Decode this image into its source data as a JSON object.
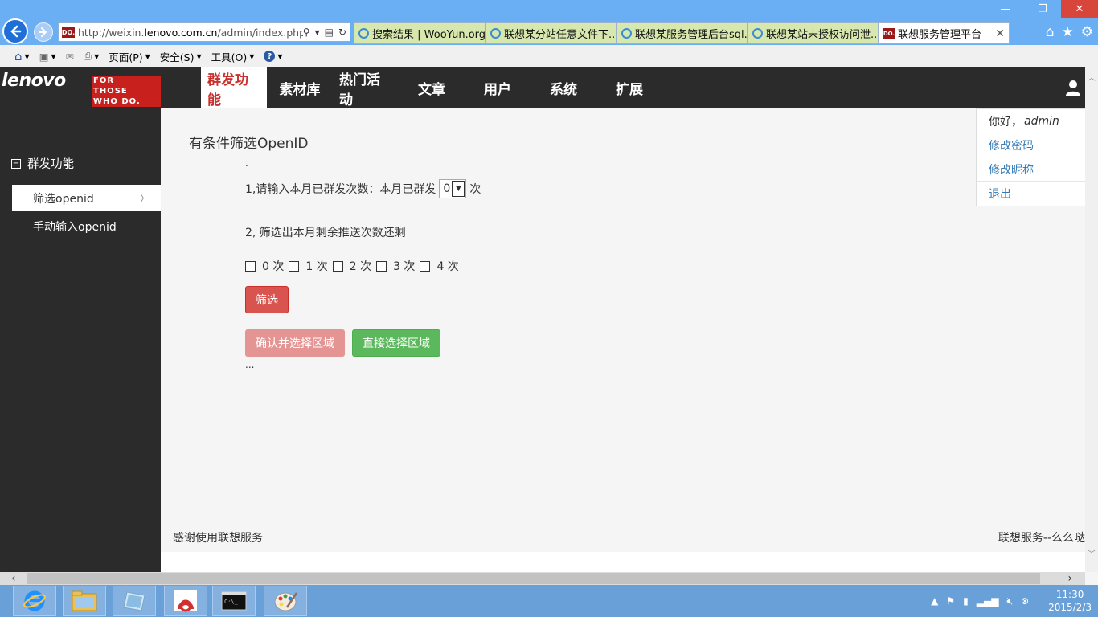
{
  "browser": {
    "url_prefix": "http://weixin.",
    "url_host": "lenovo.com.cn",
    "url_rest": "/admin/index.php?s",
    "favicon_label": "DO.",
    "tabs": [
      {
        "label": "搜索结果 | WooYun.org"
      },
      {
        "label": "联想某分站任意文件下..."
      },
      {
        "label": "联想某服务管理后台sql..."
      },
      {
        "label": "联想某站未授权访问泄..."
      },
      {
        "label": "联想服务管理平台"
      }
    ],
    "command_bar": {
      "page_menu": "页面(P)",
      "safety_menu": "安全(S)",
      "tools_menu": "工具(O)"
    }
  },
  "site": {
    "logo_text": "lenovo",
    "logo_tag": [
      "FOR",
      "THOSE",
      "WHO DO."
    ],
    "nav": [
      {
        "label": "群发功能"
      },
      {
        "label": "素材库"
      },
      {
        "label": "热门活动"
      },
      {
        "label": "文章"
      },
      {
        "label": "用户"
      },
      {
        "label": "系统"
      },
      {
        "label": "扩展"
      }
    ]
  },
  "user_menu": {
    "greeting": "你好，",
    "username": "admin",
    "change_password": "修改密码",
    "change_nickname": "修改昵称",
    "logout": "退出"
  },
  "sidebar": {
    "section_title": "群发功能",
    "items": [
      {
        "label": "筛选openid"
      },
      {
        "label": "手动输入openid"
      }
    ]
  },
  "main": {
    "title": "有条件筛选OpenID",
    "dot": ".",
    "step1_label": "1,请输入本月已群发次数：本月已群发",
    "step1_value": "0",
    "step1_suffix": "次",
    "step2_label": "2, 筛选出本月剩余推送次数还剩",
    "checkbox_options": [
      "0 次",
      "1 次",
      "2 次",
      "3 次",
      "4 次"
    ],
    "filter_button": "筛选",
    "confirm_button": "确认并选择区域",
    "direct_button": "直接选择区域",
    "ellipsis": "..."
  },
  "footer": {
    "left": "感谢使用联想服务",
    "right": "联想服务--么么哒"
  },
  "taskbar": {
    "time": "11:30",
    "date": "2015/2/3"
  }
}
